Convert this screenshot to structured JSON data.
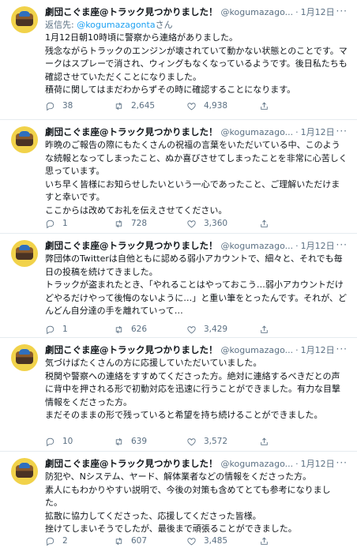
{
  "tweets": [
    {
      "name": "劇団こぐま座@トラック見つかりました！",
      "handle": "@kogumazago...",
      "time": "1月12日",
      "reply_prefix": "返信先: ",
      "reply_mention": "@kogumazagonta",
      "reply_suffix": "さん",
      "text": "1月12日朝10時頃に警察から連絡がありました。\n残念ながらトラックのエンジンが壊されていて動かない状態とのことです。マークはスプレーで消され、ウィングもなくなっているようです。後日私たちも確認させていただくことになりました。\n積荷に関してはまだわからずその時に確認することになります。",
      "replies": "38",
      "retweets": "2,645",
      "likes": "4,938"
    },
    {
      "name": "劇団こぐま座@トラック見つかりました！",
      "handle": "@kogumazago...",
      "time": "1月12日",
      "text": "昨晩のご報告の際にもたくさんの祝福の言葉をいただいている中、このような続報となってしまったこと、ぬか喜びさせてしまったことを非常に心苦しく思っています。\nいち早く皆様にお知らせしたいという一心であったこと、ご理解いただけますと幸いです。\nここからは改めてお礼を伝えさせてください。",
      "replies": "1",
      "retweets": "728",
      "likes": "3,360"
    },
    {
      "name": "劇団こぐま座@トラック見つかりました！",
      "handle": "@kogumazago...",
      "time": "1月12日",
      "text": "弊団体のTwitterは自他ともに認める弱小アカウントで、細々と、それでも毎日の投稿を続けてきました。\nトラックが盗まれたとき、「やれることはやっておこう…弱小アカウントだけどやるだけやって後悔のないように…」と重い筆をとったんです。それが、どんどん自分達の手を離れていって…",
      "replies": "1",
      "retweets": "626",
      "likes": "3,429"
    },
    {
      "name": "劇団こぐま座@トラック見つかりました！",
      "handle": "@kogumazago...",
      "time": "1月12日",
      "text": "気づけばたくさんの方に応援していただいていました。\n税関や警察への連絡をすすめてくださった方。絶対に連絡するべきだとの声に背中を押される形で初動対応を迅速に行うことができました。有力な目撃情報をくださった方。\nまだそのままの形で残っていると希望を持ち続けることができました。",
      "replies": "10",
      "retweets": "639",
      "likes": "3,572"
    },
    {
      "name": "劇団こぐま座@トラック見つかりました！",
      "handle": "@kogumazago...",
      "time": "1月12日",
      "text": "防犯や、Nシステム、ヤード、解体業者などの情報をくださった方。\n素人にもわかりやすい説明で、今後の対策も含めてとても参考になりました。\n拡散に協力してくださった、応援してくださった皆様。\n挫けてしまいそうでしたが、最後まで頑張ることができました。",
      "replies": "2",
      "retweets": "607",
      "likes": "3,485"
    }
  ]
}
